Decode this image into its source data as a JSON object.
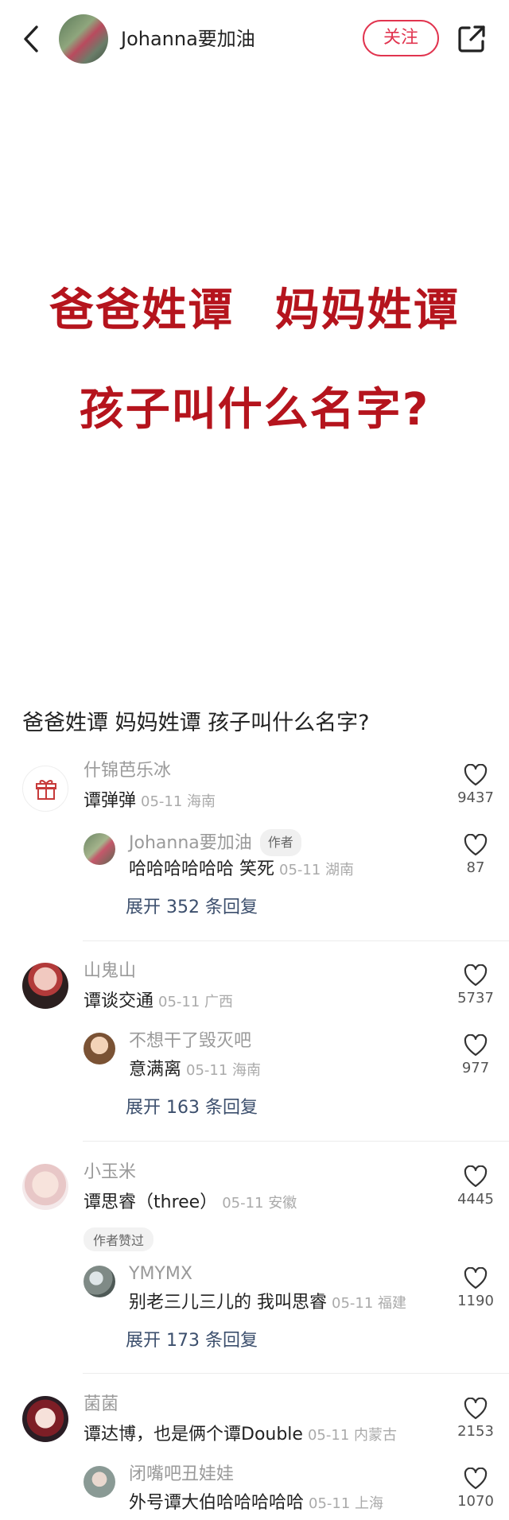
{
  "header": {
    "author_name": "Johanna要加油",
    "follow_label": "关注",
    "icons": [
      "back-arrow-icon",
      "share-icon"
    ]
  },
  "post": {
    "image_line1": "爸爸姓谭  妈妈姓谭",
    "image_line2": "孩子叫什么名字?",
    "title": "爸爸姓谭 妈妈姓谭 孩子叫什么名字?"
  },
  "comments": [
    {
      "name": "什锦芭乐冰",
      "text": "谭弹弹",
      "meta": "05-11 海南",
      "likes": "9437",
      "avatar_icon": "gift-icon",
      "reply": {
        "name": "Johanna要加油",
        "tag": "作者",
        "text": "哈哈哈哈哈哈 笑死",
        "meta": "05-11 湖南",
        "likes": "87"
      },
      "expand": "展开 352 条回复"
    },
    {
      "name": "山鬼山",
      "text": "谭谈交通",
      "meta": "05-11 广西",
      "likes": "5737",
      "reply": {
        "name": "不想干了毁灭吧",
        "text": "意满离",
        "meta": "05-11 海南",
        "likes": "977"
      },
      "expand": "展开 163 条回复"
    },
    {
      "name": "小玉米",
      "text": "谭思睿（three）",
      "meta": "05-11 安徽",
      "likes": "4445",
      "liked_tag": "作者赞过",
      "reply": {
        "name": "YMYMX",
        "text": "别老三儿三儿的 我叫思睿",
        "meta": "05-11 福建",
        "likes": "1190"
      },
      "expand": "展开 173 条回复"
    },
    {
      "name": "菌菌",
      "text": "谭达博，也是俩个谭Double",
      "meta": "05-11 内蒙古",
      "likes": "2153",
      "reply": {
        "name": "闭嘴吧丑娃娃",
        "text": "外号谭大伯哈哈哈哈哈",
        "meta": "05-11 上海",
        "likes": "1070"
      }
    }
  ],
  "colors": {
    "accent": "#e1344f",
    "headline": "#b5141d",
    "expand": "#3c4f6d"
  }
}
